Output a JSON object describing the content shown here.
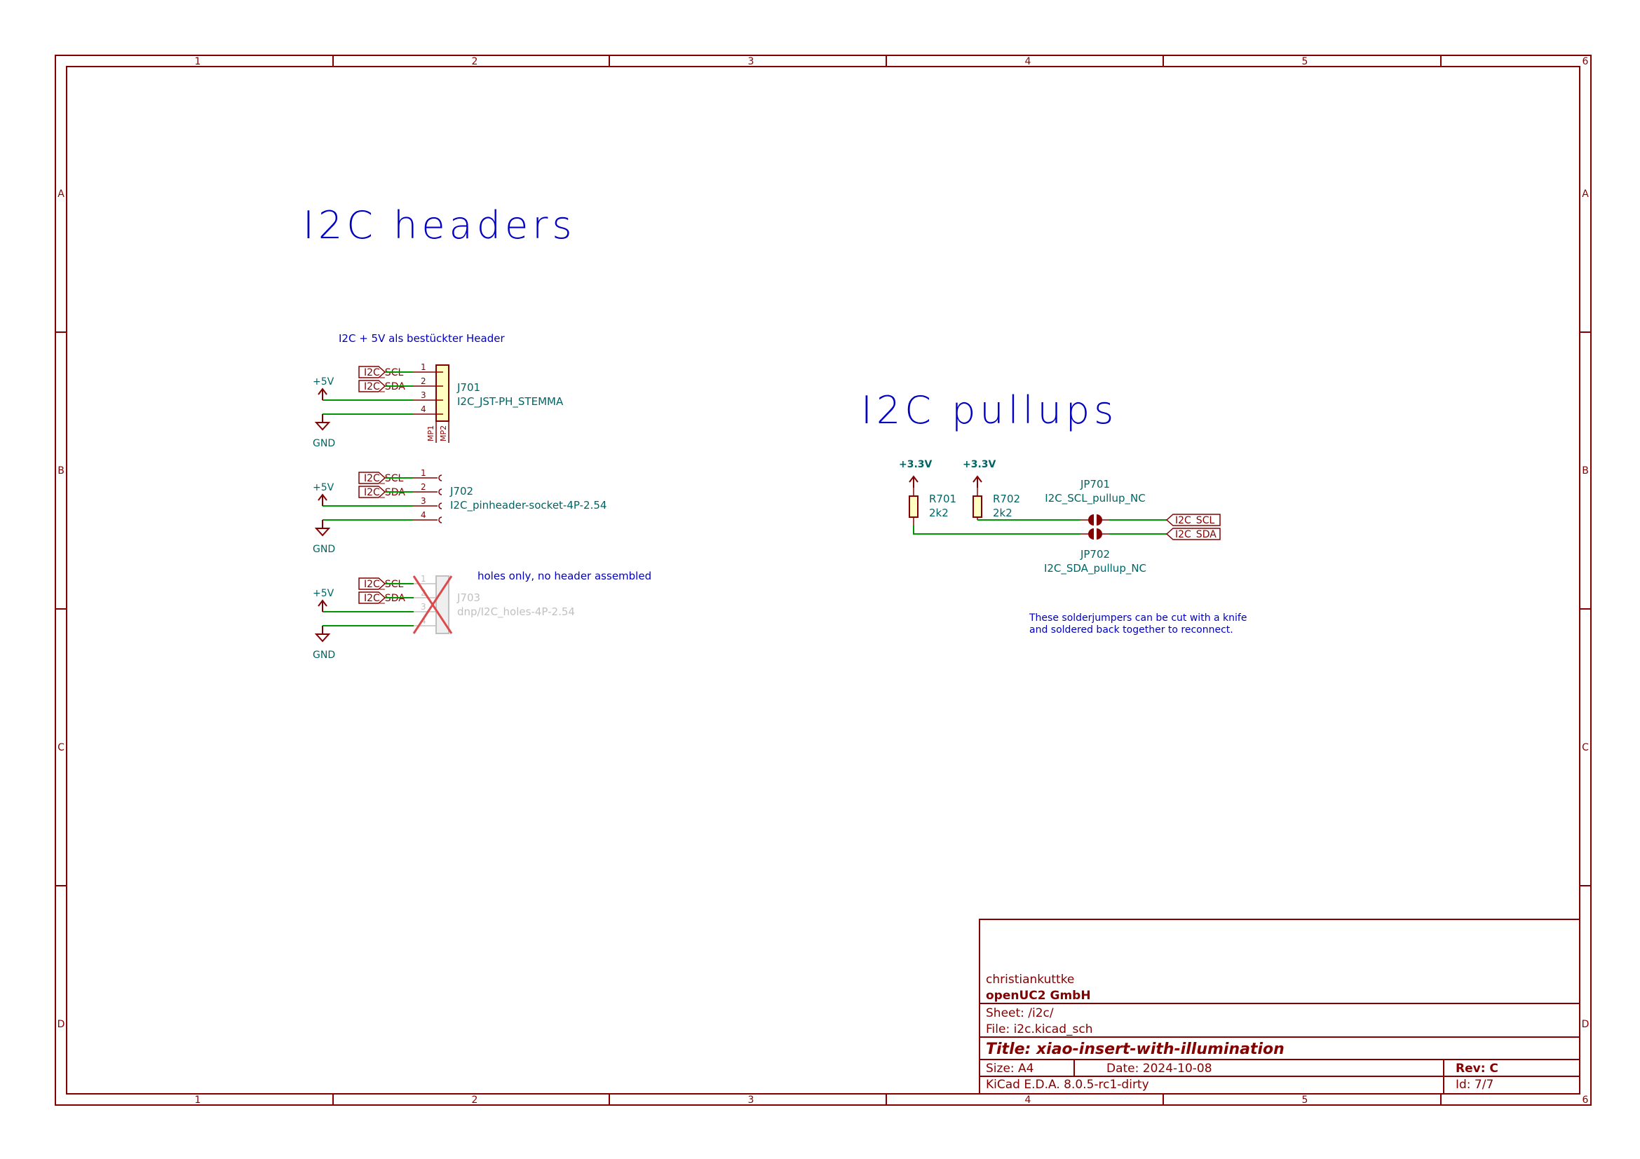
{
  "frame": {
    "columns": [
      "1",
      "2",
      "3",
      "4",
      "5",
      "6"
    ],
    "rows": [
      "A",
      "B",
      "C",
      "D"
    ]
  },
  "headings": {
    "i2c_headers": "I2C headers",
    "i2c_pullups": "I2C pullups"
  },
  "notes": {
    "header_note": "I2C + 5V als bestückter Header",
    "holes_note": "holes only, no header assembled",
    "jumper_note_1": "These solderjumpers can be cut with a knife",
    "jumper_note_2": "and soldered back together to reconnect."
  },
  "power": {
    "v5": "+5V",
    "gnd": "GND",
    "v33": "+3.3V"
  },
  "labels": {
    "scl": "I2C_SCL",
    "sda": "I2C_SDA"
  },
  "pins": [
    "1",
    "2",
    "3",
    "4"
  ],
  "mounting_pins": [
    "MP1",
    "MP2"
  ],
  "components": {
    "j701_ref": "J701",
    "j701_value": "I2C_JST-PH_STEMMA",
    "j702_ref": "J702",
    "j702_value": "I2C_pinheader-socket-4P-2.54",
    "j703_ref": "J703",
    "j703_value": "dnp/I2C_holes-4P-2.54",
    "r701_ref": "R701",
    "r701_value": "2k2",
    "r702_ref": "R702",
    "r702_value": "2k2",
    "jp701_ref": "JP701",
    "jp701_value": "I2C_SCL_pullup_NC",
    "jp702_ref": "JP702",
    "jp702_value": "I2C_SDA_pullup_NC"
  },
  "title_block": {
    "author": "christiankuttke",
    "company": "openUC2 GmbH",
    "sheet": "Sheet: /i2c/",
    "file": "File: i2c.kicad_sch",
    "title": "Title: xiao-insert-with-illumination",
    "size": "Size: A4",
    "date": "Date: 2024-10-08",
    "rev": "Rev: C",
    "tool": "KiCad E.D.A. 8.0.5-rc1-dirty",
    "id": "Id: 7/7"
  },
  "colors": {
    "frame": "#840000",
    "wire": "#009600",
    "note": "#0000c2",
    "component": "#840000",
    "body_fill": "#ffffc2",
    "ref_text": "#006464",
    "dnp": "#c0c0c0",
    "dnp_cross": "#dc4b4b"
  }
}
